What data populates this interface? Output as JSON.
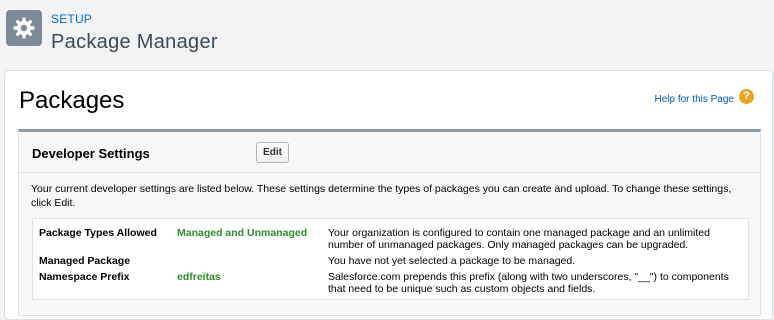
{
  "header": {
    "section": "SETUP",
    "title": "Package Manager",
    "icon": "gear-icon"
  },
  "main": {
    "title": "Packages",
    "help_link": "Help for this Page",
    "help_icon": "?"
  },
  "developer_settings": {
    "title": "Developer Settings",
    "edit_label": "Edit",
    "description": "Your current developer settings are listed below. These settings determine the types of packages you can create and upload. To change these settings, click Edit.",
    "rows": [
      {
        "label": "Package Types Allowed",
        "value": "Managed and Unmanaged",
        "note": "Your organization is configured to contain one managed package and an unlimited number of unmanaged packages. Only managed packages can be upgraded."
      },
      {
        "label": "Managed Package",
        "value": "",
        "note": "You have not yet selected a package to be managed."
      },
      {
        "label": "Namespace Prefix",
        "value": "edfreitas",
        "note": "Salesforce.com prepends this prefix (along with two underscores, \"__\") to components that need to be unique such as custom objects and fields."
      }
    ]
  },
  "colors": {
    "link": "#0070d2",
    "value_green": "#2a8e2a",
    "help_icon": "#e8a525",
    "gear_bg": "#7e8a99"
  }
}
